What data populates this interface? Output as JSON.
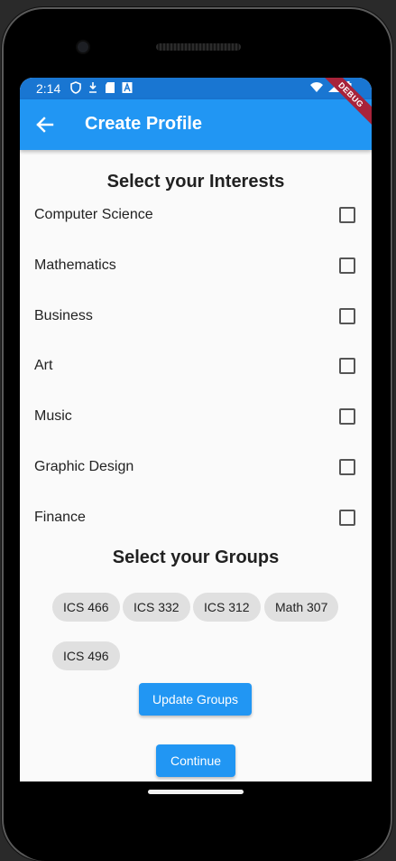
{
  "status_bar": {
    "time": "2:14",
    "left_icons": [
      "shield-icon",
      "download-icon",
      "sd-card-icon",
      "a-icon"
    ],
    "right_icons": [
      "wifi-icon",
      "signal-icon",
      "battery-icon"
    ]
  },
  "app_bar": {
    "title": "Create Profile",
    "back_icon": "arrow-back-icon",
    "debug_banner": "DEBUG",
    "color": "#2196f3"
  },
  "interests": {
    "title": "Select your Interests",
    "items": [
      {
        "label": "Computer Science",
        "checked": false
      },
      {
        "label": "Mathematics",
        "checked": false
      },
      {
        "label": "Business",
        "checked": false
      },
      {
        "label": "Art",
        "checked": false
      },
      {
        "label": "Music",
        "checked": false
      },
      {
        "label": "Graphic Design",
        "checked": false
      },
      {
        "label": "Finance",
        "checked": false
      }
    ]
  },
  "groups": {
    "title": "Select your Groups",
    "chips": [
      "ICS 466",
      "ICS 332",
      "ICS 312",
      "Math 307",
      "ICS 496"
    ]
  },
  "buttons": {
    "update_groups": "Update Groups",
    "continue": "Continue"
  }
}
